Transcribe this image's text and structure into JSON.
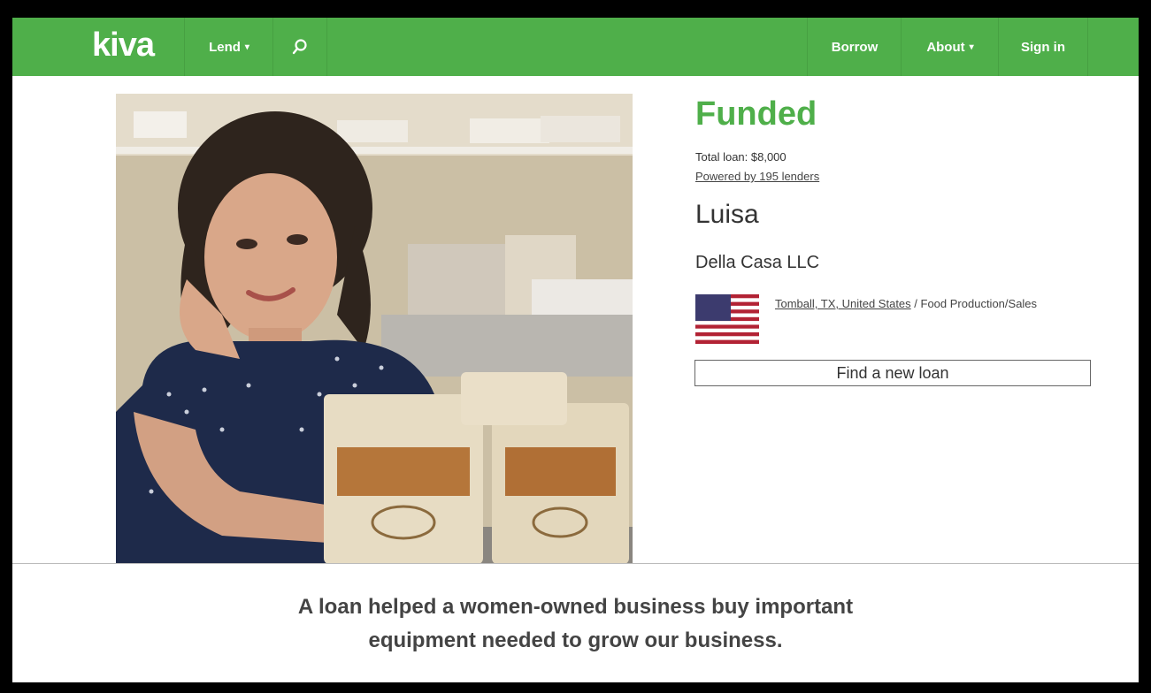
{
  "nav": {
    "logo": "kiva",
    "lend_label": "Lend",
    "borrow_label": "Borrow",
    "about_label": "About",
    "signin_label": "Sign in",
    "caret": "▾"
  },
  "loan": {
    "status": "Funded",
    "total": "Total loan: $8,000",
    "powered": "Powered by 195 lenders",
    "borrower_name": "Luisa",
    "business": "Della Casa LLC",
    "location_link": "Tomball, TX, United States",
    "location_sep": " / ",
    "sector": "Food Production/Sales",
    "find_button": "Find a new loan"
  },
  "quote": {
    "line1": "A loan helped a women-owned business buy important",
    "line2": "equipment needed to grow our business."
  },
  "colors": {
    "brand_green": "#4faf4a",
    "text": "#333333"
  }
}
